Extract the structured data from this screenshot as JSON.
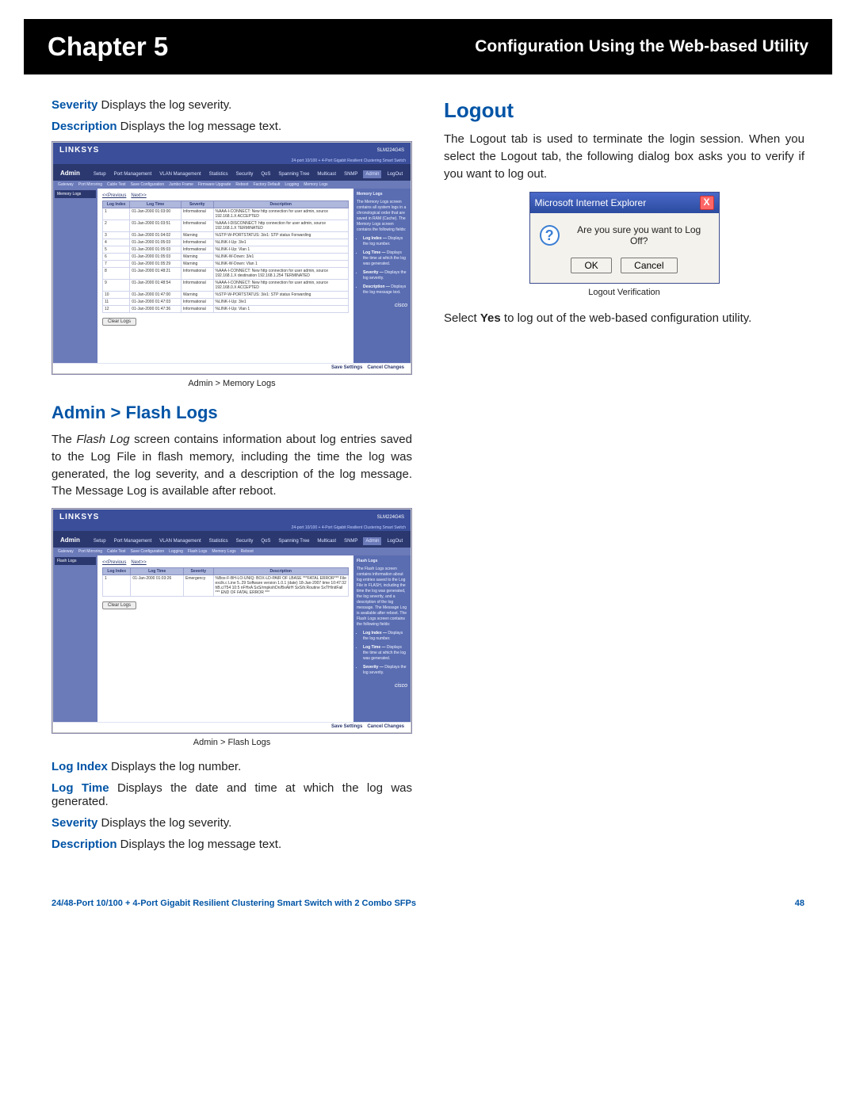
{
  "header": {
    "chapter": "Chapter 5",
    "title": "Configuration Using the Web-based Utility"
  },
  "left": {
    "defs_top": [
      {
        "term": "Severity",
        "text": "Displays the log severity."
      },
      {
        "term": "Description",
        "text": "Displays the log message text."
      }
    ],
    "shot1": {
      "brand": "LINKSYS",
      "product": "24-port 10/100 + 4-Port Gigabit Resilient Clustering Smart Switch",
      "model": "SLM224G4S",
      "admin_label": "Admin",
      "tabs": [
        "Setup",
        "Port Management",
        "VLAN Management",
        "Statistics",
        "Security",
        "QoS",
        "Spanning Tree",
        "Multicast",
        "SNMP",
        "Admin",
        "LogOut"
      ],
      "subtabs": [
        "Gateway",
        "Port Mirroring",
        "Cable Test",
        "Save Configuration",
        "Jumbo Frame",
        "Firmware Upgrade",
        "Reboot",
        "Factory Default",
        "Logging",
        "Memory Logs"
      ],
      "leftnav": "Memory Logs",
      "prevnext_prev": "<<Previous",
      "prevnext_next": "Next>>",
      "table_headers": [
        "Log Index",
        "Log Time",
        "Severity",
        "Description"
      ],
      "rows": [
        {
          "idx": "1",
          "time": "01-Jan-2000 01:03:00",
          "sev": "Informational",
          "desc": "%AAA-I-CONNECT: New http connection for user admin, source 192.168.1.X ACCEPTED"
        },
        {
          "idx": "2",
          "time": "01-Jan-2000 01:03:51",
          "sev": "Informational",
          "desc": "%AAA-I-DISCONNECT: http connection for user admin, source 192.168.1.X TERMINATED"
        },
        {
          "idx": "3",
          "time": "01-Jan-2000 01:04:02",
          "sev": "Warning",
          "desc": "%STP-W-PORTSTATUS: 3/e1: STP status Forwarding"
        },
        {
          "idx": "4",
          "time": "01-Jan-2000 01:05:03",
          "sev": "Informational",
          "desc": "%LINK-I-Up: 3/e1"
        },
        {
          "idx": "5",
          "time": "01-Jan-2000 01:05:03",
          "sev": "Informational",
          "desc": "%LINK-I-Up: Vlan 1"
        },
        {
          "idx": "6",
          "time": "01-Jan-2000 01:05:03",
          "sev": "Warning",
          "desc": "%LINK-W-Down: 3/e1"
        },
        {
          "idx": "7",
          "time": "01-Jan-2000 01:05:29",
          "sev": "Warning",
          "desc": "%LINK-W-Down: Vlan 1"
        },
        {
          "idx": "8",
          "time": "01-Jan-2000 01:48:21",
          "sev": "Informational",
          "desc": "%AAA-I-CONNECT: New http connection for user admin, source 192.168.1.X destination 192.168.1.254 TERMINATED"
        },
        {
          "idx": "9",
          "time": "01-Jan-2000 01:48:54",
          "sev": "Informational",
          "desc": "%AAA-I-CONNECT: New http connection for user admin, source 192.168.0.X ACCEPTED"
        },
        {
          "idx": "10",
          "time": "01-Jan-2000 01:47:00",
          "sev": "Warning",
          "desc": "%STP-W-PORTSTATUS: 3/e1: STP status Forwarding"
        },
        {
          "idx": "11",
          "time": "01-Jan-2000 01:47:03",
          "sev": "Informational",
          "desc": "%LINK-I-Up: 3/e1"
        },
        {
          "idx": "12",
          "time": "01-Jan-2000 01:47:36",
          "sev": "Informational",
          "desc": "%LINK-I-Up: Vlan 1"
        }
      ],
      "clear_logs": "Clear Logs",
      "side_title": "Memory Logs",
      "side_text": "The Memory Logs screen contains all system logs in a chronological order that are saved in RAM (Cache).\n\nThe Memory Logs screen contains the following fields:",
      "side_items": [
        {
          "t": "Log Index —",
          "d": "Displays the log number."
        },
        {
          "t": "Log Time —",
          "d": "Displays the time at which the log was generated."
        },
        {
          "t": "Severity —",
          "d": "Displays the log severity."
        },
        {
          "t": "Description —",
          "d": "Displays the log message text."
        }
      ],
      "cisco": "cisco",
      "footer_save": "Save Settings",
      "footer_cancel": "Cancel Changes"
    },
    "caption1": "Admin > Memory Logs",
    "heading_flash": "Admin > Flash Logs",
    "flash_body": "The Flash Log screen contains information about log entries saved to the Log File in flash memory, including the time the log was generated, the log severity, and a description of the log message. The Message Log is available after reboot.",
    "shot2": {
      "brand": "LINKSYS",
      "product": "24-port 10/100 + 4-Port Gigabit Resilient Clustering Smart Switch",
      "model": "SLM224G4S",
      "admin_label": "Admin",
      "tabs": [
        "Setup",
        "Port Management",
        "VLAN Management",
        "Statistics",
        "Security",
        "QoS",
        "Spanning Tree",
        "Multicast",
        "SNMP",
        "Admin",
        "LogOut"
      ],
      "subtabs": [
        "Gateway",
        "Port Mirroring",
        "Cable Test",
        "Save Configuration",
        "Logging",
        "Flash Logs",
        "Memory Logs",
        "Reboot"
      ],
      "leftnav": "Flash Logs",
      "prevnext_prev": "<<Previous",
      "prevnext_next": "Next>>",
      "table_headers": [
        "Log Index",
        "Log Time",
        "Severity",
        "Description"
      ],
      "rows": [
        {
          "idx": "1",
          "time": "01-Jan-2000 01:03:26",
          "sev": "Emergency",
          "desc": "%Box-F-BH-LO-UNIQ: BOX-LD-PAIR OF LBASE ***FATAL ERROR*** File exclk.c Line 5..29 Software version 1.0.1 (date) 18-Jan-2007 time 10:47:32 hB.c/754 10:5 nFHxA SxS/rmpkxhDn/BxAlrH SxS/tr.Routine SxTHInitFail *** END OF FATAL ERROR ***"
        }
      ],
      "clear_logs": "Clear Logs",
      "side_title": "Flash Logs",
      "side_text": "The Flash Logs screen contains information about log entries saved to the Log File in FLASH, including the time the log was generated, the log severity, and a description of the log message. The Message Log is available after reboot.\n\nThe Flash Logs screen contains the following fields:",
      "side_items": [
        {
          "t": "Log Index —",
          "d": "Displays the log number."
        },
        {
          "t": "Log Time —",
          "d": "Displays the time at which the log was generated."
        },
        {
          "t": "Severity —",
          "d": "Displays the log severity."
        }
      ],
      "cisco": "cisco",
      "footer_save": "Save Settings",
      "footer_cancel": "Cancel Changes"
    },
    "caption2": "Admin > Flash Logs",
    "defs_bottom": [
      {
        "term": "Log Index",
        "text": "Displays the log number."
      },
      {
        "term": "Log Time",
        "text": "Displays the date and time at which the log was generated."
      },
      {
        "term": "Severity",
        "text": "Displays the log severity."
      },
      {
        "term": "Description",
        "text": "Displays the log message text."
      }
    ]
  },
  "right": {
    "heading": "Logout",
    "body1": "The Logout tab is used to terminate the login session. When you select the Logout tab, the following dialog box asks you to verify if you want to log out.",
    "dialog": {
      "title": "Microsoft Internet Explorer",
      "close": "X",
      "message": "Are you sure you want to Log Off?",
      "ok": "OK",
      "cancel": "Cancel"
    },
    "caption": "Logout Verification",
    "body2_a": "Select ",
    "body2_b": "Yes",
    "body2_c": " to log out of the web-based configuration utility."
  },
  "footer": {
    "text": "24/48-Port 10/100 + 4-Port Gigabit Resilient Clustering Smart Switch with 2 Combo SFPs",
    "page": "48"
  }
}
